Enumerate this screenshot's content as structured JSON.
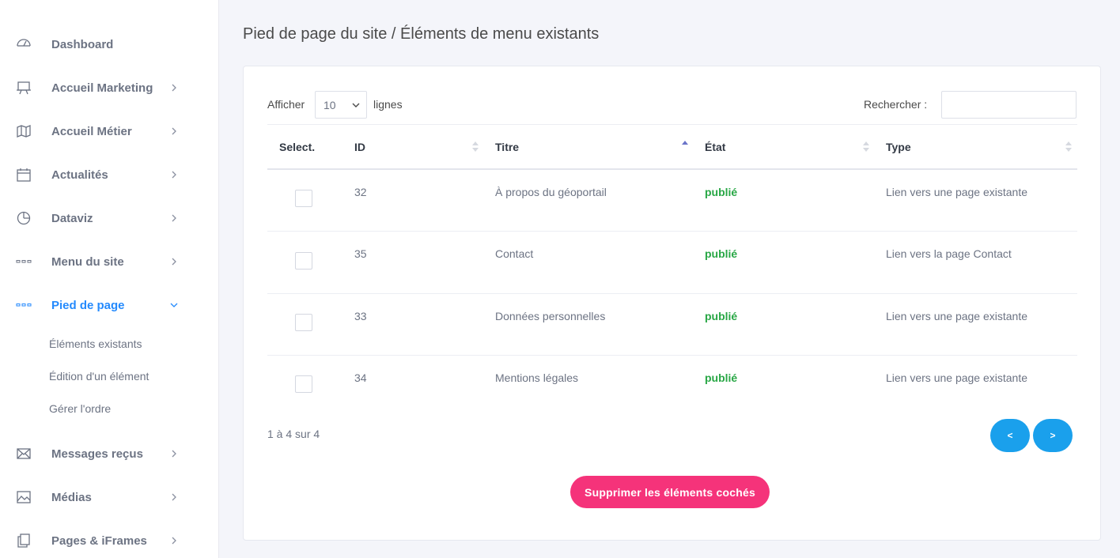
{
  "sidebar": {
    "items": [
      {
        "label": "Dashboard",
        "icon": "gauge-icon"
      },
      {
        "label": "Accueil Marketing",
        "icon": "presentation-icon"
      },
      {
        "label": "Accueil Métier",
        "icon": "map-icon"
      },
      {
        "label": "Actualités",
        "icon": "calendar-icon"
      },
      {
        "label": "Dataviz",
        "icon": "pie-chart-icon"
      },
      {
        "label": "Menu du site",
        "icon": "dots-icon"
      },
      {
        "label": "Pied de page",
        "icon": "dots-icon"
      },
      {
        "label": "Messages reçus",
        "icon": "envelope-icon"
      },
      {
        "label": "Médias",
        "icon": "image-icon"
      },
      {
        "label": "Pages & iFrames",
        "icon": "documents-icon"
      }
    ],
    "subitems": [
      "Éléments existants",
      "Édition d'un élément",
      "Gérer l'ordre"
    ],
    "active_color": "#248afd"
  },
  "page": {
    "title": "Pied de page du site / Éléments de menu existants"
  },
  "controls": {
    "show_label": "Afficher",
    "page_size": "10",
    "rows_label": "lignes",
    "search_label": "Rechercher :",
    "search_value": ""
  },
  "table": {
    "headers": [
      "Select.",
      "ID",
      "Titre",
      "État",
      "Type"
    ],
    "rows": [
      {
        "id": "32",
        "title": "À propos du géoportail",
        "state": "publié",
        "type": "Lien vers une page existante"
      },
      {
        "id": "35",
        "title": "Contact",
        "state": "publié",
        "type": "Lien vers la page Contact"
      },
      {
        "id": "33",
        "title": "Données personnelles",
        "state": "publié",
        "type": "Lien vers une page existante"
      },
      {
        "id": "34",
        "title": "Mentions légales",
        "state": "publié",
        "type": "Lien vers une page existante"
      }
    ],
    "info": "1 à 4 sur 4",
    "prev_label": "<",
    "next_label": ">"
  },
  "actions": {
    "delete_label": "Supprimer les éléments cochés"
  },
  "colors": {
    "state_published": "#28a745",
    "pagination": "#1aa0ec",
    "delete": "#f5337a"
  }
}
